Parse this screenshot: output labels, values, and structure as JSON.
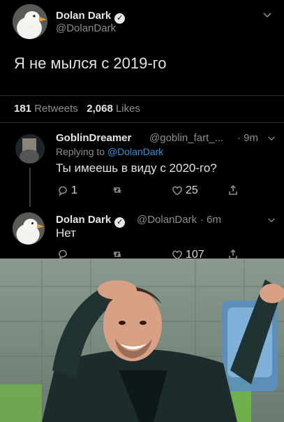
{
  "main_tweet": {
    "author_name": "Dolan Dark",
    "author_handle": "@DolanDark",
    "text": "Я не мылся с 2019-го",
    "retweets_count": "181",
    "retweets_label": "Retweets",
    "likes_count": "2,068",
    "likes_label": "Likes"
  },
  "reply1": {
    "author_name": "GoblinDreamer",
    "author_handle": "@goblin_fart_...",
    "time": "· 9m",
    "replying_prefix": "Replying to",
    "replying_to": "@DolanDark",
    "text": "Ты имеешь в виду с 2020-го?",
    "reply_count": "1",
    "retweet_count": "",
    "like_count": "25"
  },
  "reply2": {
    "author_name": "Dolan Dark",
    "author_handle": "@DolanDark",
    "time": "· 6m",
    "text": "Нет",
    "like_count": "107"
  },
  "colors": {
    "background": "#000000",
    "text": "#e2e2e2",
    "muted": "#8a8d91",
    "link": "#3b8fd6"
  },
  "icons": [
    "chevron-down-icon",
    "verified-icon",
    "reply-icon",
    "retweet-icon",
    "like-icon",
    "share-icon"
  ]
}
